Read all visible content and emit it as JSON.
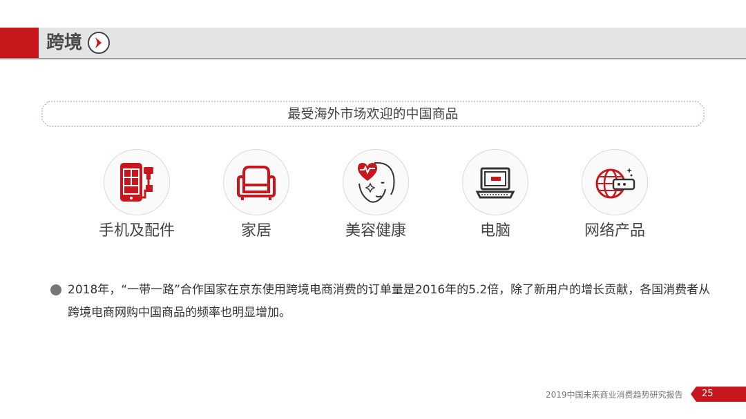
{
  "header": {
    "title": "跨境",
    "accent_color": "#c8161d",
    "arrow_icon": "chevron-right-circle-icon"
  },
  "banner": {
    "text": "最受海外市场欢迎的中国商品"
  },
  "categories": [
    {
      "label": "手机及配件",
      "icon": "phone-charger-icon"
    },
    {
      "label": "家居",
      "icon": "armchair-icon"
    },
    {
      "label": "美容健康",
      "icon": "face-heart-icon"
    },
    {
      "label": "电脑",
      "icon": "laptop-icon"
    },
    {
      "label": "网络产品",
      "icon": "globe-router-icon"
    }
  ],
  "paragraph": {
    "text": "2018年，“一带一路”合作国家在京东使用跨境电商消费的订单量是2016年的5.2倍，除了新用户的增长贡献，各国消费者从跨境电商网购中国商品的频率也明显增加。"
  },
  "footer": {
    "report_title": "2019中国未来商业消费趋势研究报告",
    "page_number": "25"
  }
}
